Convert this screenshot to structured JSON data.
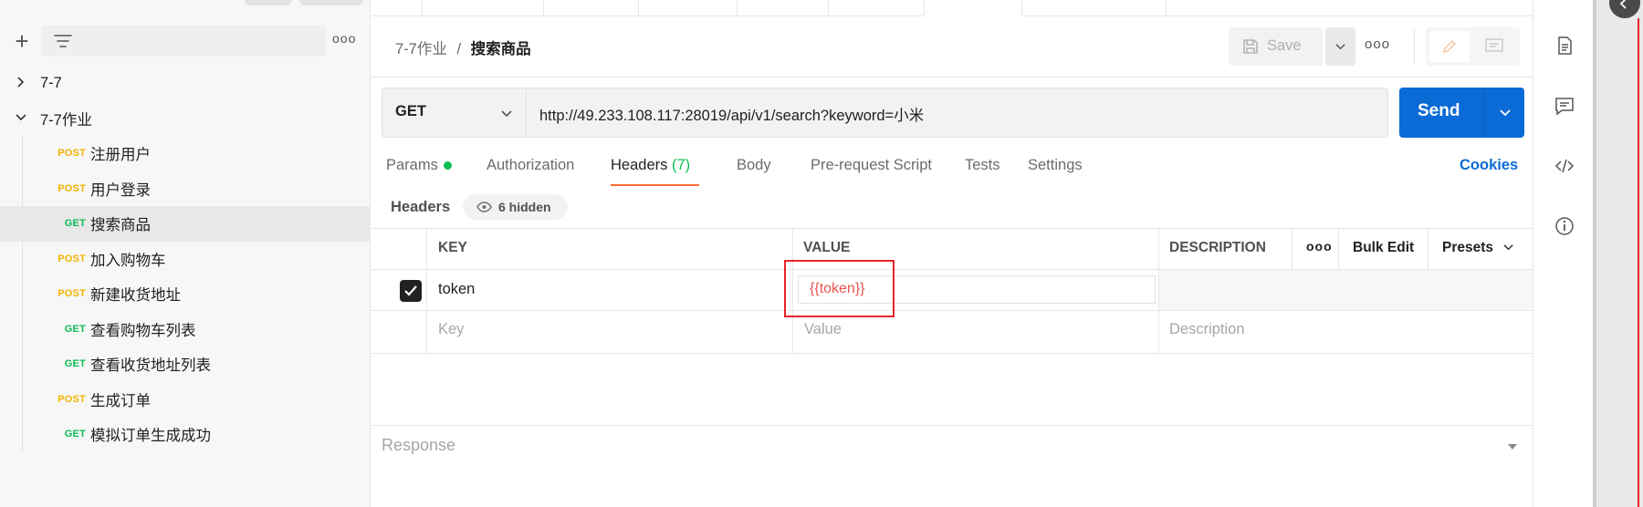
{
  "sidebar": {
    "more_label": "ooo",
    "tree": [
      {
        "type": "folder",
        "label": "7-7",
        "expanded": false
      },
      {
        "type": "folder",
        "label": "7-7作业",
        "expanded": true
      },
      {
        "type": "request",
        "method": "POST",
        "label": "注册用户"
      },
      {
        "type": "request",
        "method": "POST",
        "label": "用户登录"
      },
      {
        "type": "request",
        "method": "GET",
        "label": "搜索商品",
        "active": true
      },
      {
        "type": "request",
        "method": "POST",
        "label": "加入购物车"
      },
      {
        "type": "request",
        "method": "POST",
        "label": "新建收货地址"
      },
      {
        "type": "request",
        "method": "GET",
        "label": "查看购物车列表"
      },
      {
        "type": "request",
        "method": "GET",
        "label": "查看收货地址列表"
      },
      {
        "type": "request",
        "method": "POST",
        "label": "生成订单"
      },
      {
        "type": "request",
        "method": "GET",
        "label": "模拟订单生成成功"
      }
    ]
  },
  "header": {
    "breadcrumb_parent": "7-7作业",
    "breadcrumb_sep": "/",
    "breadcrumb_current": "搜索商品",
    "save_label": "Save",
    "more_label": "ooo"
  },
  "request": {
    "method": "GET",
    "url": "http://49.233.108.117:28019/api/v1/search?keyword=小米",
    "send_label": "Send"
  },
  "tabs": {
    "params": "Params",
    "authorization": "Authorization",
    "headers": "Headers",
    "headers_count": "(7)",
    "body": "Body",
    "prerequest": "Pre-request Script",
    "tests": "Tests",
    "settings": "Settings",
    "cookies": "Cookies"
  },
  "headers_panel": {
    "label": "Headers",
    "hidden_badge": "6 hidden",
    "columns": {
      "key": "KEY",
      "value": "VALUE",
      "description": "DESCRIPTION",
      "more": "ooo",
      "bulk_edit": "Bulk Edit",
      "presets": "Presets"
    },
    "rows": [
      {
        "checked": true,
        "key": "token",
        "value": "{{token}}",
        "description": ""
      }
    ],
    "placeholder": {
      "key": "Key",
      "value": "Value",
      "description": "Description"
    }
  },
  "response": {
    "label": "Response"
  },
  "colors": {
    "accent": "#0a6bd6",
    "post": "#f2b400",
    "get": "#0cbb52",
    "tab_active": "#ff6c37",
    "var": "#e8554e",
    "highlight": "#e8252a"
  }
}
